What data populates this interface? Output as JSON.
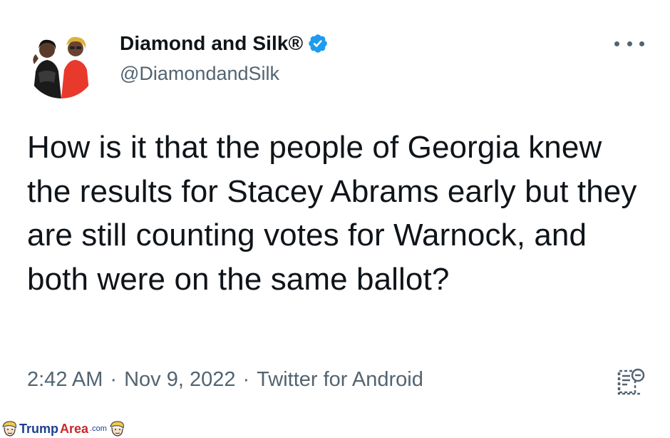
{
  "tweet": {
    "display_name": "Diamond and Silk®",
    "handle": "@DiamondandSilk",
    "verified": true,
    "text": "How is it that the people of Georgia knew the results for Stacey Abrams early but they are still counting votes for Warnock, and both were on the same ballot?",
    "time": "2:42 AM",
    "date": "Nov 9, 2022",
    "source": "Twitter for Android",
    "separator": "·"
  },
  "icons": {
    "verified": "verified-badge-icon",
    "more": "more-options-icon",
    "analytics": "tweet-analytics-icon"
  },
  "colors": {
    "text": "#0f1419",
    "secondary": "#536471",
    "verified_blue": "#1d9bf0",
    "watermark_blue": "#1d3f8f",
    "watermark_red": "#c9262c"
  },
  "watermark": {
    "part1": "Trump",
    "part2": "Area",
    "part3": ".com"
  }
}
